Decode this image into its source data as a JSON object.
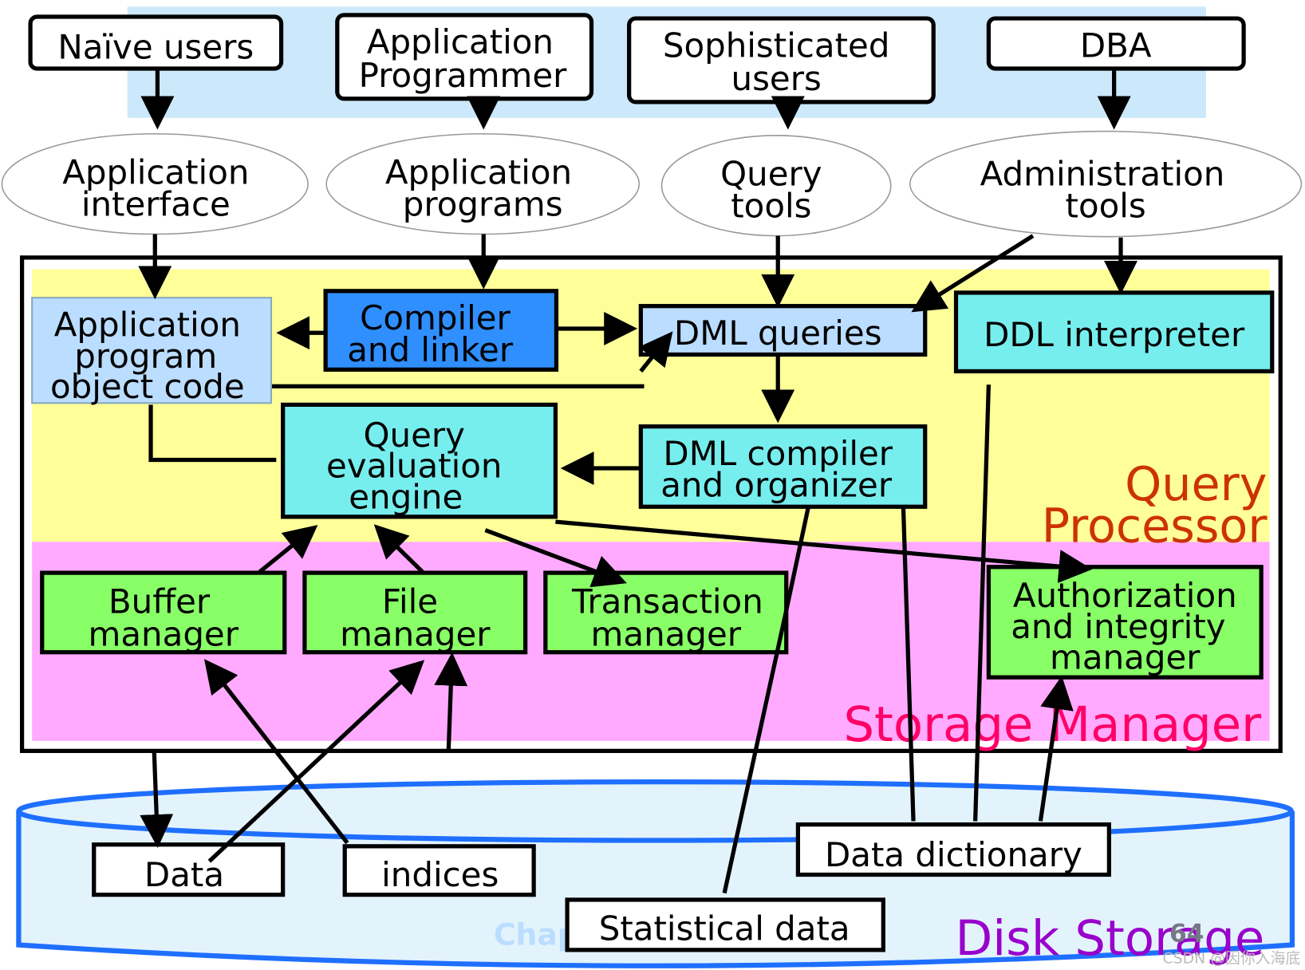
{
  "users": [
    "Naïve users",
    [
      "Application",
      "Programmer"
    ],
    [
      "Sophisticated",
      "users"
    ],
    "DBA"
  ],
  "tools": [
    [
      "Application",
      "interface"
    ],
    [
      "Application",
      "programs"
    ],
    [
      "Query",
      "tools"
    ],
    [
      "Administration",
      "tools"
    ]
  ],
  "query_processor": {
    "label": [
      "Query",
      "Processor"
    ],
    "app_object_code": [
      "Application",
      "program",
      "object code"
    ],
    "compiler": [
      "Compiler",
      "and linker"
    ],
    "dml_queries": "DML queries",
    "ddl_interpreter": "DDL interpreter",
    "query_engine": [
      "Query",
      "evaluation",
      "engine"
    ],
    "dml_compiler": [
      "DML compiler",
      "and organizer"
    ]
  },
  "storage_manager": {
    "label": "Storage Manager",
    "buffer": [
      "Buffer",
      "manager"
    ],
    "file": [
      "File",
      "manager"
    ],
    "transaction": [
      "Transaction",
      "manager"
    ],
    "auth": [
      "Authorization",
      "and integrity",
      "manager"
    ]
  },
  "disk_storage": {
    "label": "Disk Storage",
    "data": "Data",
    "indices": "indices",
    "data_dictionary": "Data dictionary",
    "statistical_data": "Statistical data"
  },
  "footer": {
    "chapter": "Chap",
    "page_number": "64",
    "watermark": "CSDN @因你入海底"
  },
  "colors": {
    "user_band": "#cce8fb",
    "query_processor": "#ffff99",
    "storage_manager": "#ffaaff",
    "disk": "#e3f3fc",
    "disk_edge": "#1f6fff",
    "light_blue_box": "#bbddff",
    "dark_blue_box": "#2f8fff",
    "cyan_box": "#77eeee",
    "green_box": "#88ff66",
    "query_label": "#cc3300",
    "storage_label": "#ff0066",
    "disk_label": "#9900cc"
  }
}
